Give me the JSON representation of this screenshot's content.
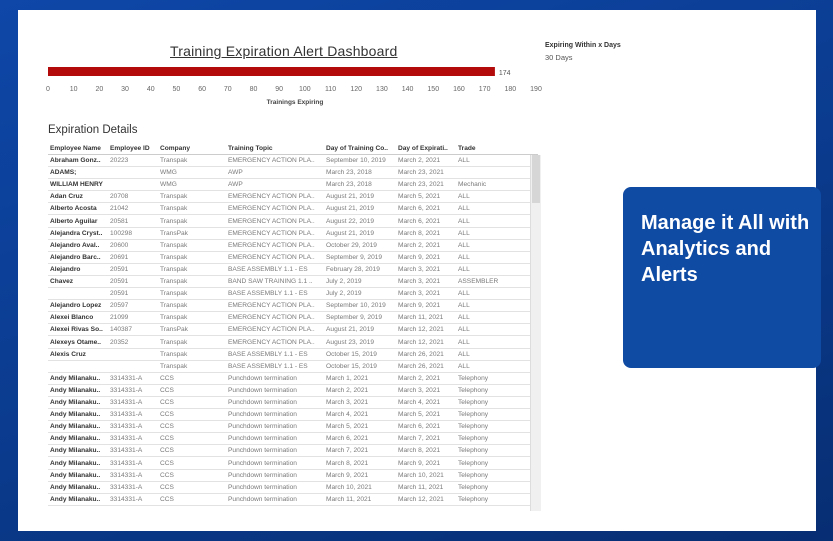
{
  "dashboard": {
    "title": "Training Expiration Alert Dashboard",
    "expiring_label": "Expiring Within x Days",
    "expiring_value": "30 Days"
  },
  "chart_data": {
    "type": "bar",
    "orientation": "horizontal",
    "categories": [
      ""
    ],
    "values": [
      174
    ],
    "bar_color": "#b30b0b",
    "value_label": "174",
    "xlabel": "Trainings Expiring",
    "xlim": [
      0,
      190
    ],
    "xticks": [
      "0",
      "10",
      "20",
      "30",
      "40",
      "50",
      "60",
      "70",
      "80",
      "90",
      "100",
      "110",
      "120",
      "130",
      "140",
      "150",
      "160",
      "170",
      "180",
      "190"
    ]
  },
  "details": {
    "title": "Expiration Details",
    "columns": [
      "Employee Name",
      "Employee ID",
      "Company",
      "Training Topic",
      "Day of Training Co..",
      "Day of Expirati..",
      "Trade"
    ],
    "rows": [
      [
        "Abraham Gonz..",
        "20223",
        "Transpak",
        "EMERGENCY ACTION PLA..",
        "September 10, 2019",
        "March 2, 2021",
        "ALL"
      ],
      [
        "ADAMS;",
        "",
        "WMG",
        "AWP",
        "March 23, 2018",
        "March 23, 2021",
        ""
      ],
      [
        "WILLIAM HENRY",
        "",
        "WMG",
        "AWP",
        "March 23, 2018",
        "March 23, 2021",
        "Mechanic"
      ],
      [
        "Adan Cruz",
        "20708",
        "Transpak",
        "EMERGENCY ACTION PLA..",
        "August 21, 2019",
        "March 5, 2021",
        "ALL"
      ],
      [
        "Alberto Acosta",
        "21042",
        "Transpak",
        "EMERGENCY ACTION PLA..",
        "August 21, 2019",
        "March 6, 2021",
        "ALL"
      ],
      [
        "Alberto Aguilar",
        "20581",
        "Transpak",
        "EMERGENCY ACTION PLA..",
        "August 22, 2019",
        "March 6, 2021",
        "ALL"
      ],
      [
        "Alejandra Cryst..",
        "100298",
        "TransPak",
        "EMERGENCY ACTION PLA..",
        "August 21, 2019",
        "March 8, 2021",
        "ALL"
      ],
      [
        "Alejandro Aval..",
        "20600",
        "Transpak",
        "EMERGENCY ACTION PLA..",
        "October 29, 2019",
        "March 2, 2021",
        "ALL"
      ],
      [
        "Alejandro Barc..",
        "20691",
        "Transpak",
        "EMERGENCY ACTION PLA..",
        "September 9, 2019",
        "March 9, 2021",
        "ALL"
      ],
      [
        "Alejandro",
        "20591",
        "Transpak",
        "BASE ASSEMBLY 1.1 - ES",
        "February 28, 2019",
        "March 3, 2021",
        "ALL"
      ],
      [
        "Chavez",
        "20591",
        "Transpak",
        "BAND SAW TRAINING 1.1 ..",
        "July 2, 2019",
        "March 3, 2021",
        "ASSEMBLER"
      ],
      [
        "",
        "20591",
        "Transpak",
        "BASE ASSEMBLY 1.1 - ES",
        "July 2, 2019",
        "March 3, 2021",
        "ALL"
      ],
      [
        "Alejandro Lopez",
        "20597",
        "Transpak",
        "EMERGENCY ACTION PLA..",
        "September 10, 2019",
        "March 9, 2021",
        "ALL"
      ],
      [
        "Alexei Blanco",
        "21099",
        "Transpak",
        "EMERGENCY ACTION PLA..",
        "September 9, 2019",
        "March 11, 2021",
        "ALL"
      ],
      [
        "Alexei Rivas So..",
        "140387",
        "TransPak",
        "EMERGENCY ACTION PLA..",
        "August 21, 2019",
        "March 12, 2021",
        "ALL"
      ],
      [
        "Alexeys Otame..",
        "20352",
        "Transpak",
        "EMERGENCY ACTION PLA..",
        "August 23, 2019",
        "March 12, 2021",
        "ALL"
      ],
      [
        "Alexis Cruz",
        "",
        "Transpak",
        "BASE ASSEMBLY 1.1 - ES",
        "October 15, 2019",
        "March 26, 2021",
        "ALL"
      ],
      [
        "",
        "",
        "Transpak",
        "BASE ASSEMBLY 1.1 - ES",
        "October 15, 2019",
        "March 26, 2021",
        "ALL"
      ],
      [
        "Andy Milanaku..",
        "3314331-A",
        "CCS",
        "Punchdown termination",
        "March 1, 2021",
        "March 2, 2021",
        "Telephony"
      ],
      [
        "Andy Milanaku..",
        "3314331-A",
        "CCS",
        "Punchdown termination",
        "March 2, 2021",
        "March 3, 2021",
        "Telephony"
      ],
      [
        "Andy Milanaku..",
        "3314331-A",
        "CCS",
        "Punchdown termination",
        "March 3, 2021",
        "March 4, 2021",
        "Telephony"
      ],
      [
        "Andy Milanaku..",
        "3314331-A",
        "CCS",
        "Punchdown termination",
        "March 4, 2021",
        "March 5, 2021",
        "Telephony"
      ],
      [
        "Andy Milanaku..",
        "3314331-A",
        "CCS",
        "Punchdown termination",
        "March 5, 2021",
        "March 6, 2021",
        "Telephony"
      ],
      [
        "Andy Milanaku..",
        "3314331-A",
        "CCS",
        "Punchdown termination",
        "March 6, 2021",
        "March 7, 2021",
        "Telephony"
      ],
      [
        "Andy Milanaku..",
        "3314331-A",
        "CCS",
        "Punchdown termination",
        "March 7, 2021",
        "March 8, 2021",
        "Telephony"
      ],
      [
        "Andy Milanaku..",
        "3314331-A",
        "CCS",
        "Punchdown termination",
        "March 8, 2021",
        "March 9, 2021",
        "Telephony"
      ],
      [
        "Andy Milanaku..",
        "3314331-A",
        "CCS",
        "Punchdown termination",
        "March 9, 2021",
        "March 10, 2021",
        "Telephony"
      ],
      [
        "Andy Milanaku..",
        "3314331-A",
        "CCS",
        "Punchdown termination",
        "March 10, 2021",
        "March 11, 2021",
        "Telephony"
      ],
      [
        "Andy Milanaku..",
        "3314331-A",
        "CCS",
        "Punchdown termination",
        "March 11, 2021",
        "March 12, 2021",
        "Telephony"
      ]
    ]
  },
  "promo": {
    "text": "Manage it All with Analytics and Alerts",
    "background": "#0f4aa3"
  }
}
